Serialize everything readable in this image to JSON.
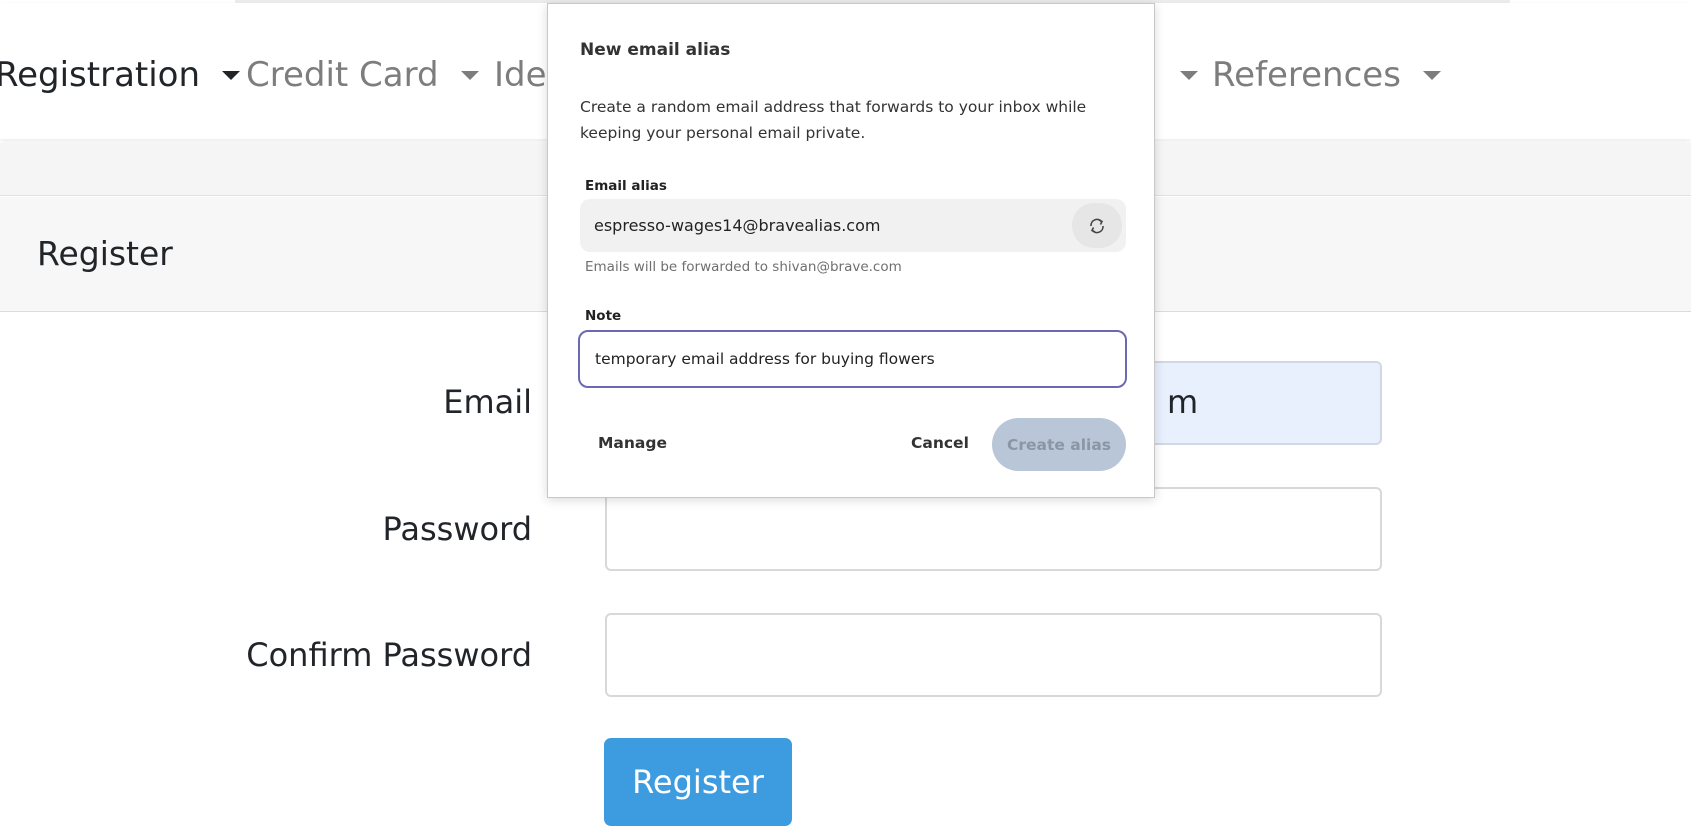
{
  "nav": {
    "items": [
      {
        "label": "Registration"
      },
      {
        "label": "Credit Card"
      },
      {
        "label": "Ider"
      },
      {
        "label": "References"
      }
    ]
  },
  "card": {
    "title": "Register"
  },
  "form": {
    "email_label": "Email",
    "email_value_visible": "m",
    "password_label": "Password",
    "confirm_label": "Confirm Password",
    "submit_label": "Register"
  },
  "popup": {
    "title": "New email alias",
    "description": "Create a random email address that forwards to your inbox while keeping your personal email private.",
    "alias_label": "Email alias",
    "alias_value": "espresso-wages14@bravealias.com",
    "refresh_icon": "refresh-icon",
    "helper": "Emails will be forwarded to shivan@brave.com",
    "note_label": "Note",
    "note_value": "temporary email address for buying flowers",
    "manage_label": "Manage",
    "cancel_label": "Cancel",
    "create_label": "Create alias"
  },
  "colors": {
    "accent_button": "#3d9be0",
    "note_focus_border": "#6c68b4",
    "disabled_button": "#b9c6d7"
  }
}
